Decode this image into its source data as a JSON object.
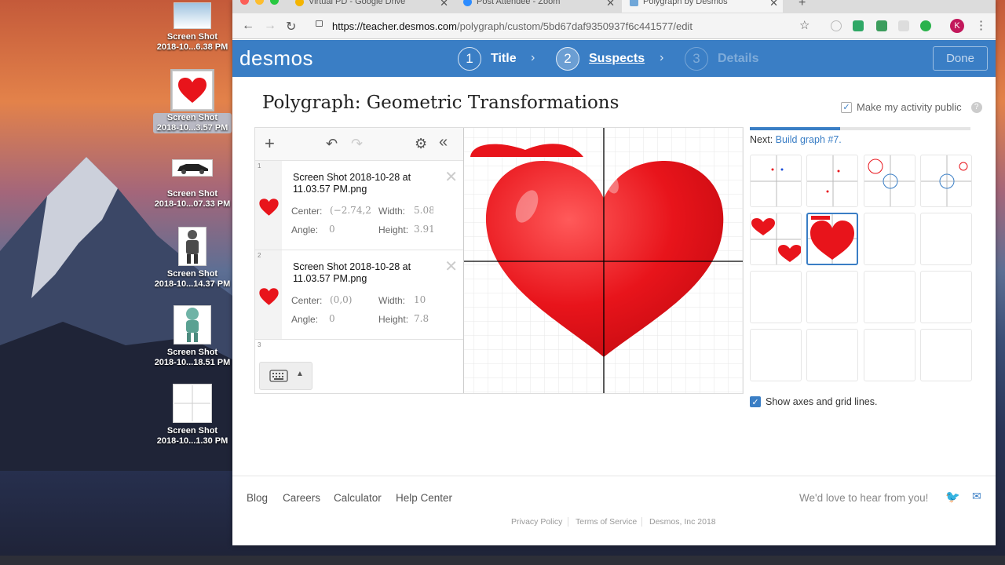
{
  "desktop": {
    "icons": [
      {
        "label1": "Screen Shot",
        "label2": "2018-10...6.38 PM",
        "icon": "screenshot-landscape-icon"
      },
      {
        "label1": "Screen Shot",
        "label2": "2018-10...3.57 PM",
        "icon": "heart-image-icon"
      },
      {
        "label1": "Screen Shot",
        "label2": "2018-10...07.33 PM",
        "icon": "car-image-icon"
      },
      {
        "label1": "Screen Shot",
        "label2": "2018-10...14.37 PM",
        "icon": "figure-image-icon"
      },
      {
        "label1": "Screen Shot",
        "label2": "2018-10...18.51 PM",
        "icon": "alien-image-icon"
      },
      {
        "label1": "Screen Shot",
        "label2": "2018-10...1.30 PM",
        "icon": "grid-image-icon"
      }
    ]
  },
  "browser": {
    "tabs": [
      {
        "title": "Virtual PD - Google Drive"
      },
      {
        "title": "Post Attendee - Zoom"
      },
      {
        "title": "Polygraph by Desmos"
      }
    ],
    "url_domain": "https://teacher.desmos.com",
    "url_path": "/polygraph/custom/5bd67daf9350937f6c441577/edit",
    "avatar_letter": "K"
  },
  "header": {
    "logo": "desmos",
    "steps": [
      {
        "num": "1",
        "label": "Title"
      },
      {
        "num": "2",
        "label": "Suspects"
      },
      {
        "num": "3",
        "label": "Details"
      }
    ],
    "done": "Done"
  },
  "page": {
    "title_prefix": "Polygraph",
    "title_sep": ":",
    "title": "Geometric Transformations",
    "public_label": "Make my activity public",
    "help": "?"
  },
  "expressions": [
    {
      "index": "1",
      "name": "Screen Shot 2018-10-28 at 11.03.57 PM.png",
      "center_label": "Center:",
      "center_value": "(−2.74,2",
      "width_label": "Width:",
      "width_value": "5.08",
      "angle_label": "Angle:",
      "angle_value": "0",
      "height_label": "Height:",
      "height_value": "3.91"
    },
    {
      "index": "2",
      "name": "Screen Shot 2018-10-28 at 11.03.57 PM.png",
      "center_label": "Center:",
      "center_value": "(0,0)",
      "width_label": "Width:",
      "width_value": "10",
      "angle_label": "Angle:",
      "angle_value": "0",
      "height_label": "Height:",
      "height_value": "7.8"
    },
    {
      "index": "3"
    }
  ],
  "side": {
    "progress": 0.41,
    "next_label": "Next:",
    "next_link": "Build graph #7.",
    "axes_label": "Show axes and grid lines."
  },
  "footer": {
    "links": [
      "Blog",
      "Careers",
      "Calculator",
      "Help Center"
    ],
    "love": "We'd love to hear from you!",
    "small": [
      "Privacy Policy",
      "Terms of Service",
      "Desmos, Inc 2018"
    ]
  },
  "colors": {
    "accent": "#3a7ec5",
    "heart": "#e8141b"
  }
}
